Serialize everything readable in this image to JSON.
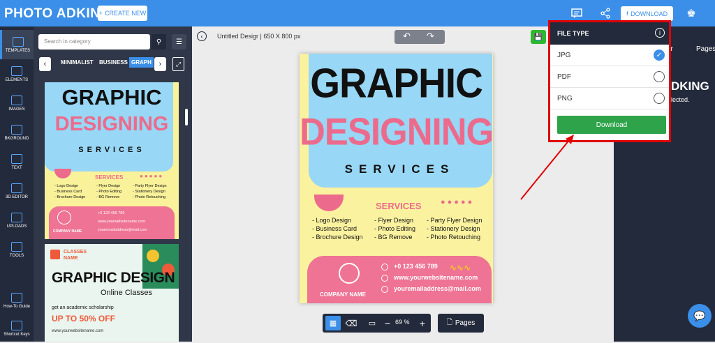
{
  "header": {
    "logo": "PHOTO ADKING",
    "create_label": "CREATE NEW",
    "download_label": "DOWNLOAD"
  },
  "rail": {
    "items": [
      {
        "label": "TEMPLATES"
      },
      {
        "label": "ELEMENTS"
      },
      {
        "label": "IMAGES"
      },
      {
        "label": "BKGROUND"
      },
      {
        "label": "TEXT"
      },
      {
        "label": "3D EDITOR"
      },
      {
        "label": "UPLOADS"
      },
      {
        "label": "TOOLS"
      },
      {
        "label": "How-To Guide"
      },
      {
        "label": "Shortcut Keys"
      }
    ]
  },
  "panel": {
    "search_placeholder": "Search in category",
    "categories": [
      "MINIMALIST",
      "BUSINESS",
      "GRAPH"
    ],
    "template1": {
      "title1": "GRAPHIC",
      "title2": "DESIGNING",
      "title3": "SERVICES",
      "services": "SERVICES",
      "col1": [
        "- Logo Design",
        "- Business Card",
        "- Brochure Design"
      ],
      "col2": [
        "- Flyer Design",
        "- Photo Editing",
        "- BG Remove"
      ],
      "col3": [
        "- Party Flyer Design",
        "- Stationery Design",
        "- Photo Retouching"
      ],
      "phone": "+0 123 456 789",
      "web": "www.yourwebsitename.com",
      "email": "youremailaddress@mail.com",
      "company": "COMPANY NAME"
    },
    "template2": {
      "classes": "CLASSES",
      "name": "NAME",
      "title": "GRAPHIC DESIGN",
      "subtitle": "Online Classes",
      "scholarship": "get an academic scholarship",
      "offer": "UP TO 50% OFF",
      "web": "www.yourwebsitename.com"
    }
  },
  "canvas": {
    "doc_title": "Untitled Desigr | 650 X 800 px",
    "poster": {
      "title1": "GRAPHIC",
      "title2": "DESIGNING",
      "title3": "SERVICES",
      "services": "SERVICES",
      "col1": [
        "- Logo Design",
        "- Business Card",
        "- Brochure Design"
      ],
      "col2": [
        "- Flyer Design",
        "- Photo Editing",
        "- BG Remove"
      ],
      "col3": [
        "- Party Flyer Design",
        "- Stationery Design",
        "- Photo Retouching"
      ],
      "phone": "+0 123 456 789",
      "web": "www.yourwebsitename.com",
      "email": "youremailaddress@mail.com",
      "company": "COMPANY NAME"
    },
    "zoom": "69 %",
    "pages_label": "Pages"
  },
  "right_panel": {
    "tab_partial": "er",
    "tab_pages": "Pages",
    "logo_partial": "DKING",
    "status_partial": "lected."
  },
  "file_type": {
    "title": "FILE TYPE",
    "options": [
      {
        "label": "JPG",
        "checked": true
      },
      {
        "label": "PDF",
        "checked": false
      },
      {
        "label": "PNG",
        "checked": false
      }
    ],
    "download_label": "Download"
  },
  "colors": {
    "accent": "#3b8fe8",
    "dark": "#232a3b",
    "highlight": "#e00000",
    "download_green": "#2ea34a",
    "poster_pink": "#ec6b8c",
    "poster_blue": "#98d7f5",
    "poster_yellow": "#fbf2a0"
  }
}
